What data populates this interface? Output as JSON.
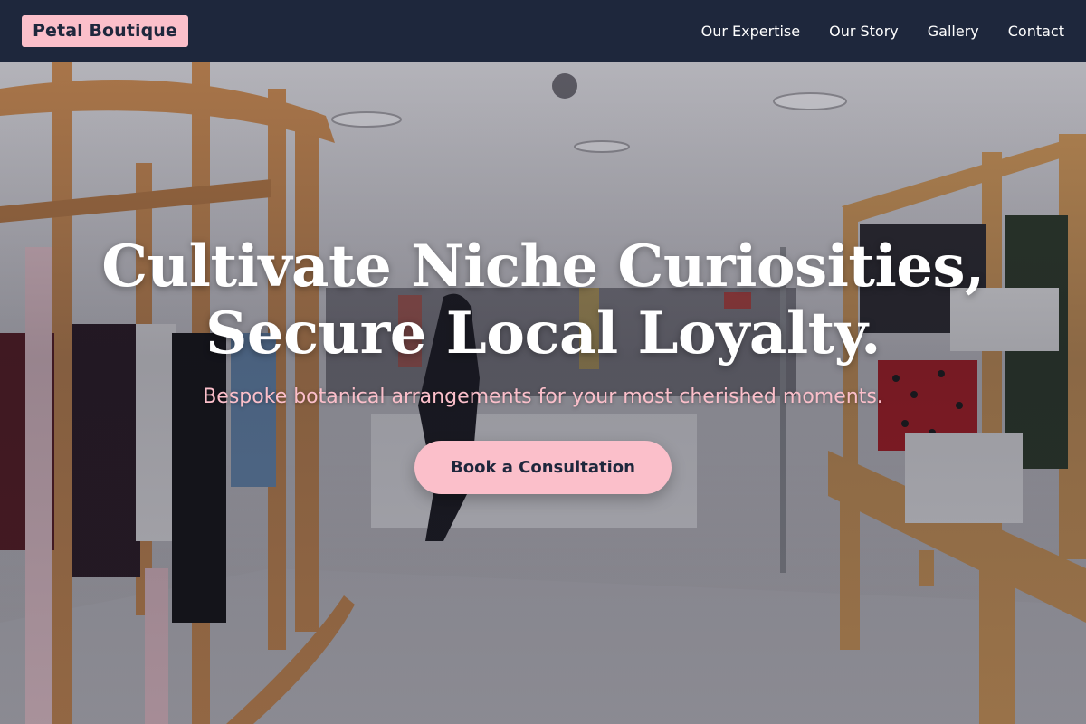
{
  "header": {
    "brand": "Petal Boutique",
    "nav": [
      "Our Expertise",
      "Our Story",
      "Gallery",
      "Contact"
    ]
  },
  "hero": {
    "headline_line1": "Cultivate Niche Curiosities,",
    "headline_line2": "Secure Local Loyalty.",
    "subtitle": "Bespoke botanical arrangements for your most cherished moments.",
    "cta_label": "Book a Consultation"
  },
  "colors": {
    "nav_bg": "#1e273c",
    "accent_pink": "#fbbfca",
    "text_dark": "#1e273c",
    "text_light": "#ffffff"
  }
}
